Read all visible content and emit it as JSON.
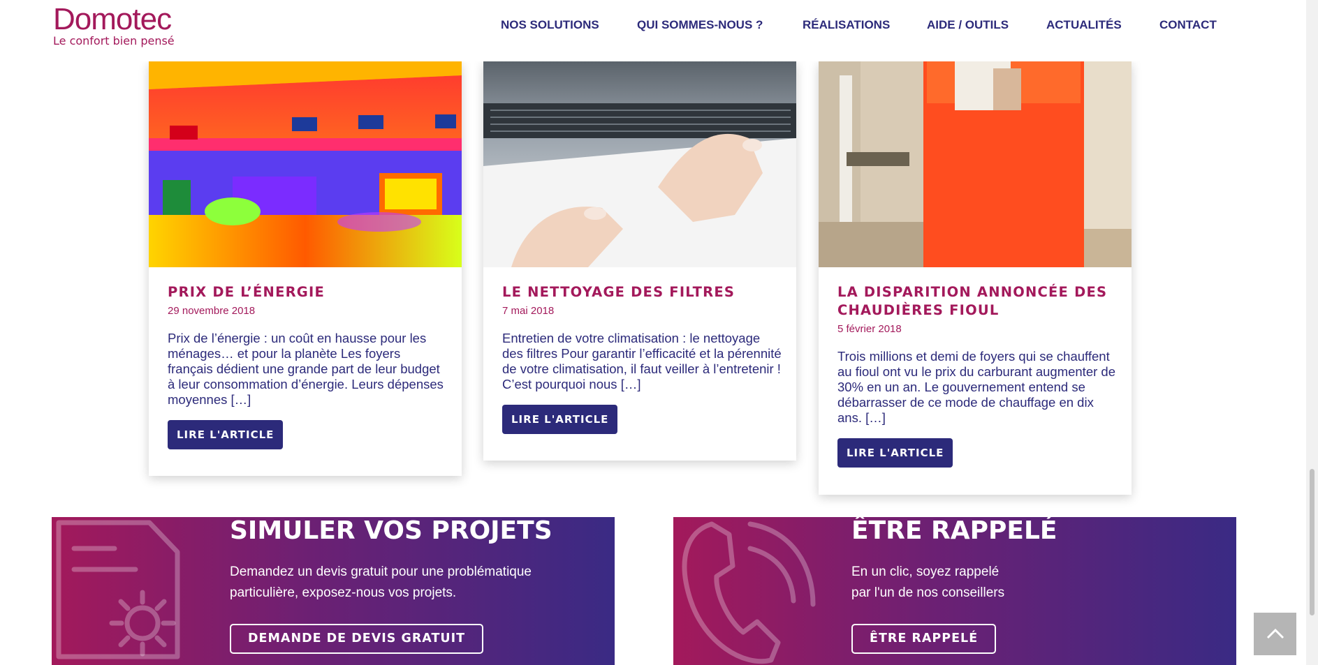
{
  "header": {
    "logo_word": "Domotec",
    "logo_tagline": "Le confort bien pensé",
    "nav": [
      "NOS SOLUTIONS",
      "QUI SOMMES-NOUS ?",
      "RÉALISATIONS",
      "AIDE / OUTILS",
      "ACTUALITÉS",
      "CONTACT"
    ]
  },
  "articles": [
    {
      "title": "PRIX DE L’ÉNERGIE",
      "date": "29 novembre 2018",
      "excerpt": "Prix de l’énergie : un coût en hausse pour les ménages… et pour la planète Les foyers français dédient une grande part de leur budget à leur consommation d’énergie. Leurs dépenses moyennes […]",
      "button": "LIRE L'ARTICLE",
      "image": "thermal-house-image"
    },
    {
      "title": "LE NETTOYAGE DES FILTRES",
      "date": "7 mai 2018",
      "excerpt": "Entretien de votre climatisation : le nettoyage des filtres Pour garantir l’efficacité et la pérennité de votre climatisation, il faut veiller à l’entretenir ! C’est pourquoi nous […]",
      "button": "LIRE L'ARTICLE",
      "image": "ac-filter-cleaning-image"
    },
    {
      "title": "LA DISPARITION ANNONCÉE DES CHAUDIÈRES FIOUL",
      "date": "5 février 2018",
      "excerpt": "Trois millions et demi de foyers qui se chauffent au fioul ont vu le prix du carburant augmenter de 30% en un an. Le gouvernement entend se débarrasser de ce mode de chauffage en dix ans. […]",
      "button": "LIRE L'ARTICLE",
      "image": "oil-boiler-image"
    }
  ],
  "banners": {
    "simulate": {
      "title": "SIMULER VOS PROJETS",
      "text": "Demandez un devis gratuit pour une problématique particulière, exposez-nous vos projets.",
      "button": "DEMANDE DE DEVIS GRATUIT",
      "icon": "document-gear-icon"
    },
    "callback": {
      "title": "ÊTRE RAPPELÉ",
      "text_line1": "En un clic, soyez rappelé",
      "text_line2": "par l'un de nos conseillers",
      "button": "ÊTRE RAPPELÉ",
      "icon": "phone-icon"
    }
  },
  "colors": {
    "brand_magenta": "#a3195b",
    "brand_navy": "#2c2a7a",
    "gradient_start": "#a3195b",
    "gradient_end": "#3a2a84"
  },
  "icons": {
    "back_to_top": "chevron-up-icon"
  }
}
